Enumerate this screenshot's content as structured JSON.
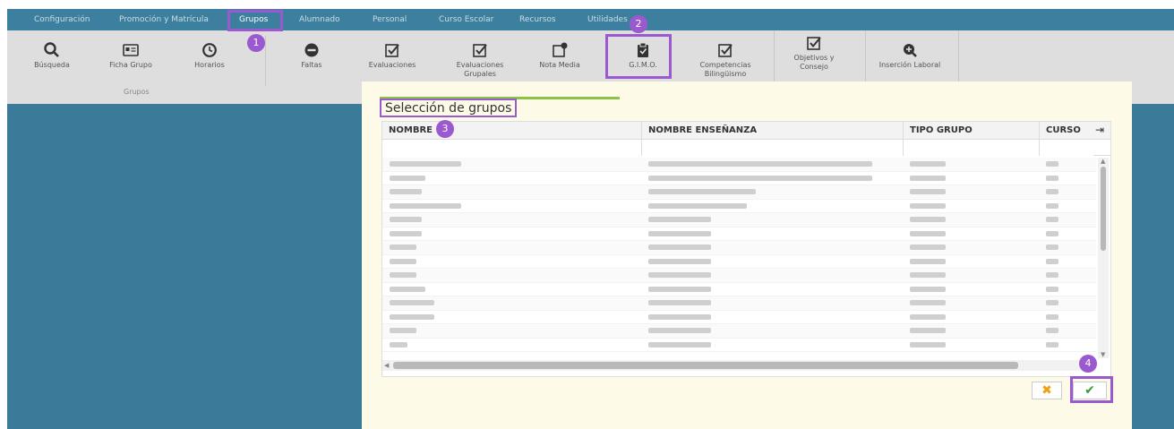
{
  "top_menu": {
    "items": [
      "Configuración",
      "Promoción y Matrícula",
      "Grupos",
      "Alumnado",
      "Personal",
      "Curso Escolar",
      "Recursos",
      "Utilidades"
    ],
    "active": "Grupos"
  },
  "ribbon": {
    "tools": [
      {
        "label": "Búsqueda",
        "icon": "search-icon"
      },
      {
        "label": "Ficha Grupo",
        "icon": "id-card-icon"
      },
      {
        "label": "Horarios",
        "icon": "clock-icon"
      },
      {
        "label": "Faltas",
        "icon": "minus-circle-icon"
      },
      {
        "label": "Evaluaciones",
        "icon": "checkbox-icon"
      },
      {
        "label": "Evaluaciones Grupales",
        "icon": "checkbox-icon"
      },
      {
        "label": "Nota Media",
        "icon": "edit-note-icon"
      },
      {
        "label": "G.I.M.O.",
        "icon": "clipboard-check-icon"
      },
      {
        "label": "Competencias Bilingüismo",
        "icon": "checkbox-icon"
      },
      {
        "label": "Objetivos y Consejo",
        "icon": "checkbox-icon"
      },
      {
        "label": "Inserción Laboral",
        "icon": "search-plus-icon"
      }
    ],
    "group_label": "Grupos"
  },
  "modal": {
    "title": "Selección de grupos",
    "columns": [
      "NOMBRE",
      "NOMBRE ENSEÑANZA",
      "TIPO GRUPO",
      "CURSO"
    ],
    "cancel_icon": "close-icon",
    "confirm_icon": "check-icon"
  },
  "badges": [
    "1",
    "2",
    "3",
    "4"
  ],
  "colors": {
    "nav": "#3d7f9e",
    "highlight": "#9b59d0",
    "accent_bar": "#8bc34a",
    "modal_bg": "#fdfae8"
  }
}
